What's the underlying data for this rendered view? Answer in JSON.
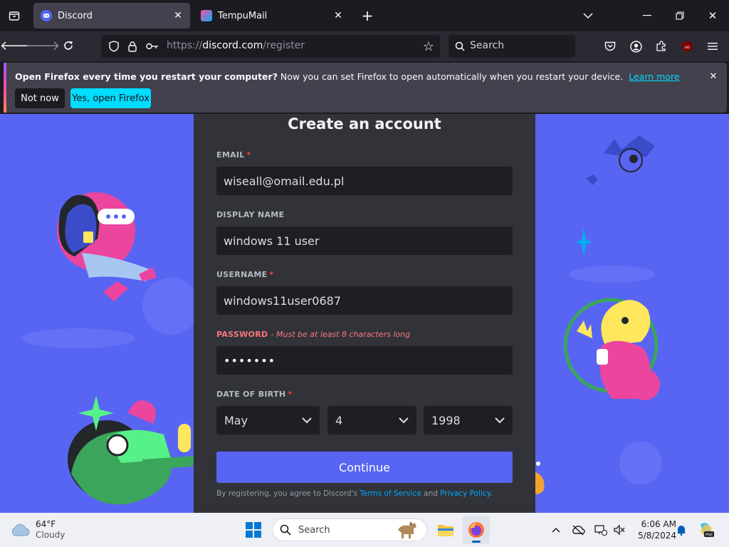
{
  "browser": {
    "tabs": [
      {
        "title": "Discord",
        "icon": "discord-icon"
      },
      {
        "title": "TempuMail",
        "icon": "tempumail-icon"
      }
    ],
    "url_prefix": "https://",
    "url_domain": "discord.com",
    "url_path": "/register",
    "search_label": "Search"
  },
  "notification": {
    "bold": "Open Firefox every time you restart your computer?",
    "text": " Now you can set Firefox to open automatically when you restart your device.",
    "link": "Learn more",
    "not_now": "Not now",
    "yes": "Yes, open Firefox"
  },
  "form": {
    "title": "Create an account",
    "email_label": "EMAIL",
    "email_value": "wiseall@omail.edu.pl",
    "display_name_label": "DISPLAY NAME",
    "display_name_value": "windows 11 user",
    "username_label": "USERNAME",
    "username_value": "windows11user0687",
    "password_label": "PASSWORD",
    "password_error": "- Must be at least 8 characters long",
    "password_value": "•••••••",
    "dob_label": "DATE OF BIRTH",
    "required_mark": "*",
    "month": "May",
    "day": "4",
    "year": "1998",
    "continue": "Continue",
    "terms_prefix": "By registering, you agree to Discord's ",
    "terms_link": "Terms of Service",
    "terms_and": " and ",
    "privacy_link": "Privacy Policy",
    "terms_suffix": "."
  },
  "taskbar": {
    "weather_temp": "64°F",
    "weather_desc": "Cloudy",
    "search": "Search",
    "time": "6:06 AM",
    "date": "5/8/2024"
  },
  "colors": {
    "discord_blurple": "#5865f2",
    "firefox_link": "#00ddff",
    "error_red": "#f23f42"
  }
}
